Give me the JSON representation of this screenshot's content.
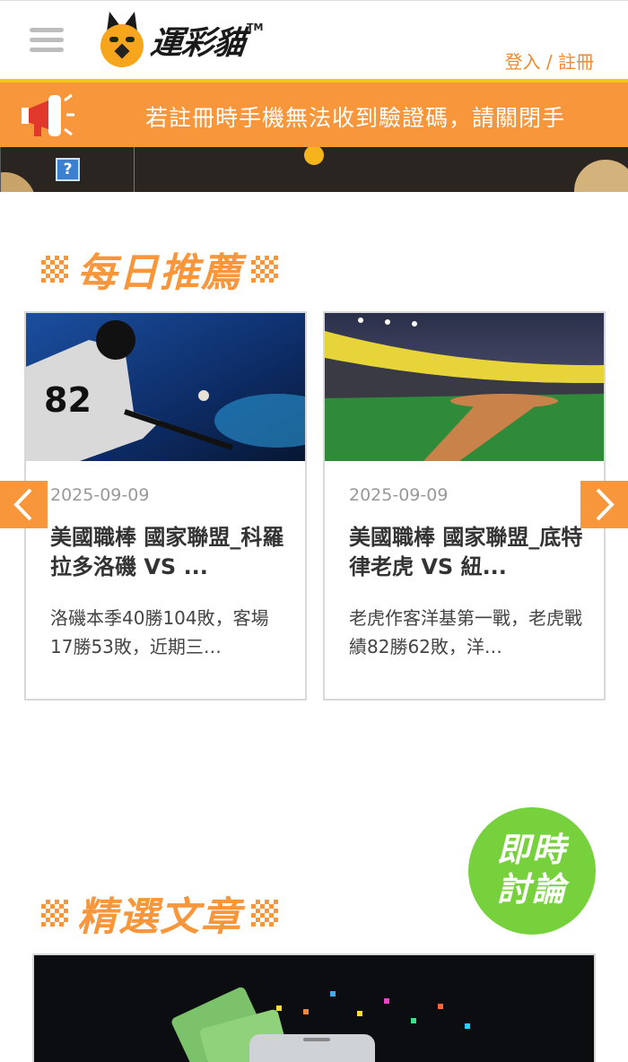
{
  "header": {
    "logo_text": "運彩貓",
    "logo_tm": "TM",
    "login_label": "登入 / 註冊"
  },
  "announcement": {
    "text": "若註冊時手機無法收到驗證碼，請關閉手"
  },
  "strip": {
    "help_label": "?"
  },
  "daily": {
    "title": "每日推薦",
    "cards": [
      {
        "date": "2025-09-09",
        "title": "美國職棒 國家聯盟_科羅拉多洛磯 VS ...",
        "desc": "洛磯本季40勝104敗，客場17勝53敗，近期三…"
      },
      {
        "date": "2025-09-09",
        "title": "美國職棒 國家聯盟_底特律老虎 VS 紐...",
        "desc": "老虎作客洋基第一戰，老虎戰績82勝62敗，洋…"
      }
    ]
  },
  "discussion": {
    "label": "即時討論"
  },
  "featured": {
    "title": "精選文章"
  },
  "colors": {
    "accent_orange": "#f7963a",
    "discussion_green": "#76d13c",
    "login_orange": "#f08a2c"
  },
  "icons": [
    "hamburger-icon",
    "cat-logo-icon",
    "megaphone-icon",
    "help-icon",
    "chevron-left-icon",
    "chevron-right-icon"
  ]
}
